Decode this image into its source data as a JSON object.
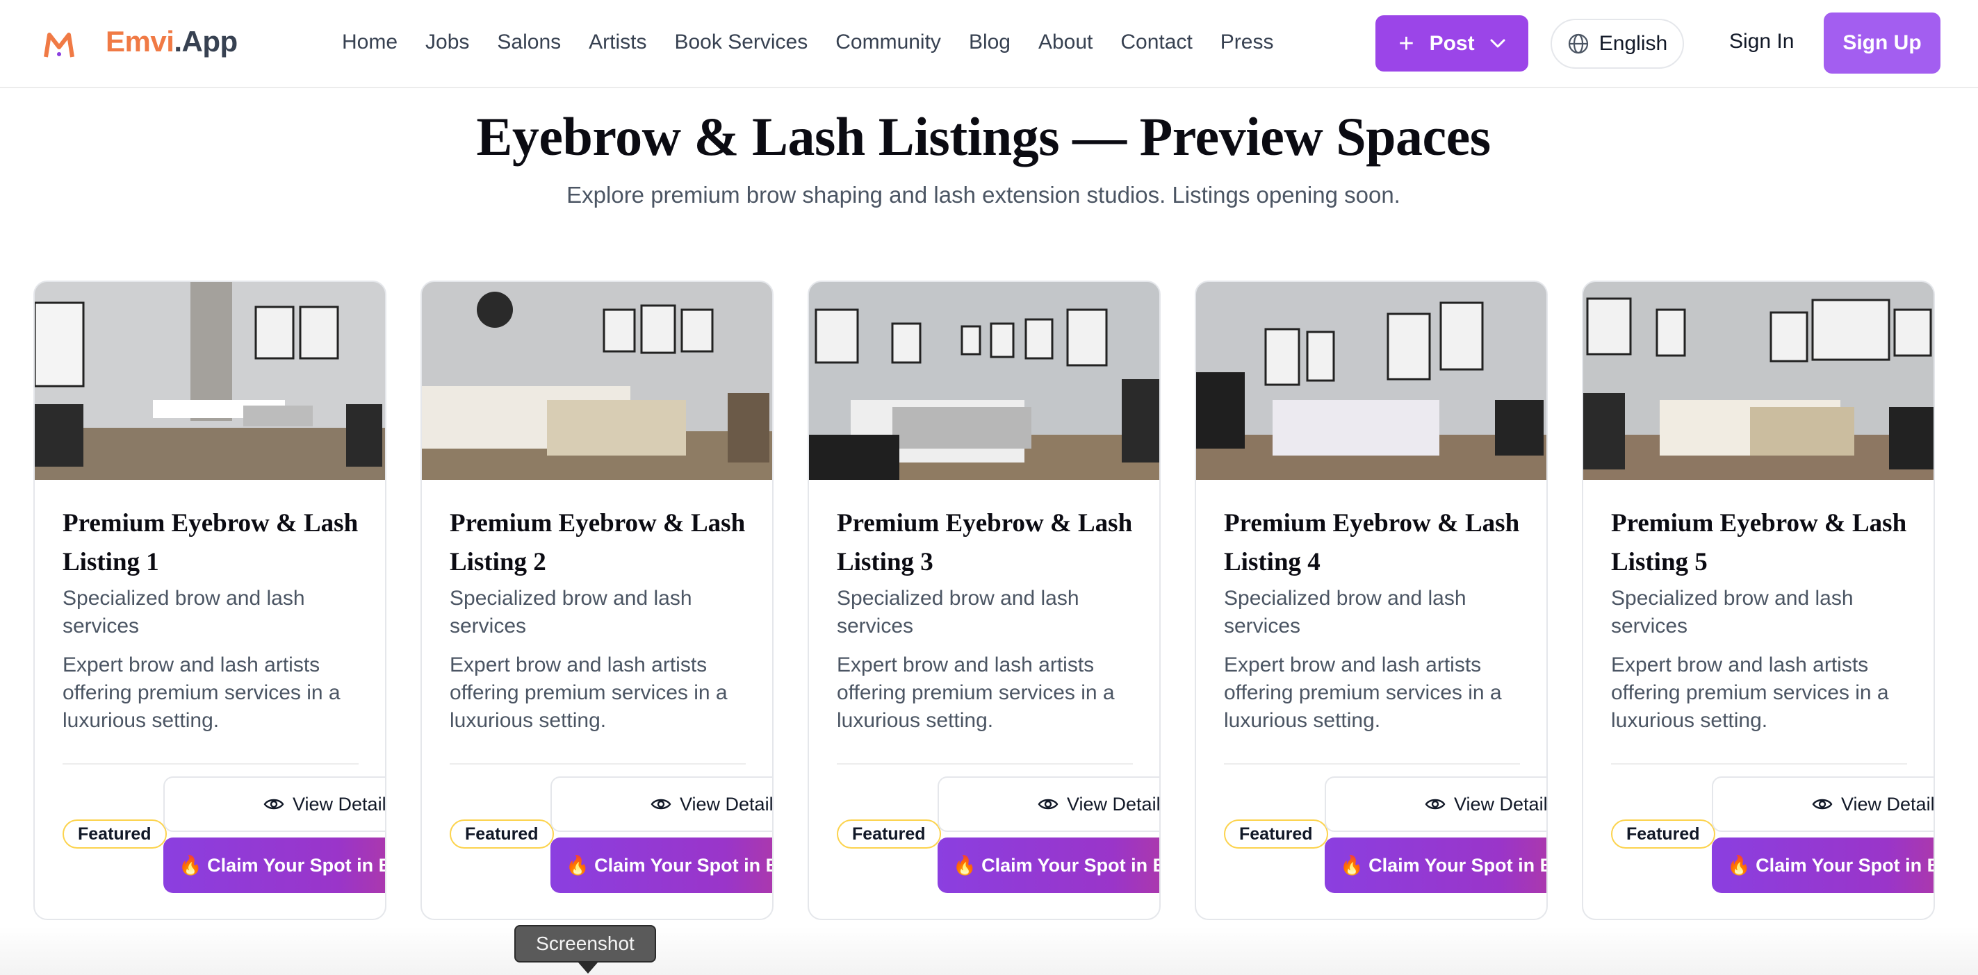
{
  "nav": {
    "logo_icon": "emvi-logo-icon",
    "brand_name": "Emvi",
    "brand_tld": ".App",
    "links": [
      "Home",
      "Jobs",
      "Salons",
      "Artists",
      "Book Services",
      "Community",
      "Blog",
      "About",
      "Contact",
      "Press"
    ],
    "post_label": "Post",
    "language_label": "English",
    "signin_label": "Sign In",
    "signup_label": "Sign Up",
    "accent_color": "#9b45e8"
  },
  "header": {
    "title": "Eyebrow & Lash Listings — Preview Spaces",
    "subtitle": "Explore premium brow shaping and lash extension studios. Listings opening soon."
  },
  "cards": [
    {
      "title": "Premium Eyebrow & Lash Listing 1",
      "subtitle": "Specialized brow and lash services",
      "description": "Expert brow and lash artists offering premium services in a luxurious setting.",
      "badge": "Featured",
      "view_label": "View Details",
      "claim_label": "🔥 Claim Your Spot in Brow"
    },
    {
      "title": "Premium Eyebrow & Lash Listing 2",
      "subtitle": "Specialized brow and lash services",
      "description": "Expert brow and lash artists offering premium services in a luxurious setting.",
      "badge": "Featured",
      "view_label": "View Details",
      "claim_label": "🔥 Claim Your Spot in Brow"
    },
    {
      "title": "Premium Eyebrow & Lash Listing 3",
      "subtitle": "Specialized brow and lash services",
      "description": "Expert brow and lash artists offering premium services in a luxurious setting.",
      "badge": "Featured",
      "view_label": "View Details",
      "claim_label": "🔥 Claim Your Spot in Brow"
    },
    {
      "title": "Premium Eyebrow & Lash Listing 4",
      "subtitle": "Specialized brow and lash services",
      "description": "Expert brow and lash artists offering premium services in a luxurious setting.",
      "badge": "Featured",
      "view_label": "View Details",
      "claim_label": "🔥 Claim Your Spot in Brow"
    },
    {
      "title": "Premium Eyebrow & Lash Listing 5",
      "subtitle": "Specialized brow and lash services",
      "description": "Expert brow and lash artists offering premium services in a luxurious setting.",
      "badge": "Featured",
      "view_label": "View Details",
      "claim_label": "🔥 Claim Your Spot in Brow"
    }
  ],
  "tooltip": {
    "label": "Screenshot"
  }
}
